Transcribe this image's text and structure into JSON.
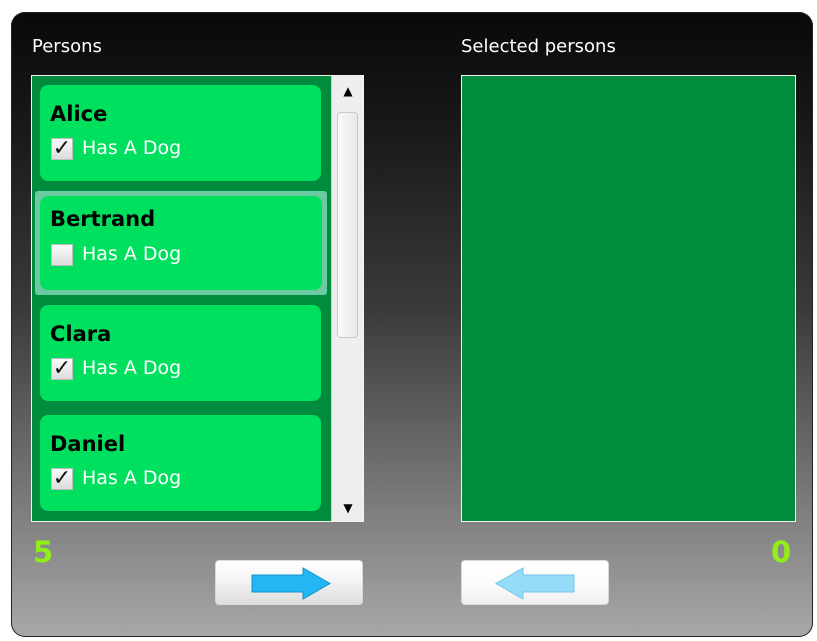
{
  "persons_panel": {
    "title": "Persons",
    "count": "5",
    "items": [
      {
        "name": "Alice",
        "has_dog_label": "Has A Dog",
        "has_dog": true
      },
      {
        "name": "Bertrand",
        "has_dog_label": "Has A Dog",
        "has_dog": false
      },
      {
        "name": "Clara",
        "has_dog_label": "Has A Dog",
        "has_dog": true
      },
      {
        "name": "Daniel",
        "has_dog_label": "Has A Dog",
        "has_dog": true
      }
    ]
  },
  "selected_panel": {
    "title": "Selected persons",
    "count": "0"
  },
  "icons": {
    "checkmark": "✓",
    "scroll_up": "▲",
    "scroll_down": "▼",
    "move_right": "right-arrow-icon",
    "move_left": "left-arrow-icon"
  },
  "colors": {
    "list_background": "#008b3d",
    "item_background": "#00e05f",
    "selected_item_border": "#6ccaa2",
    "count_color": "#92ee17",
    "active_arrow": "#22b7f3",
    "inactive_arrow": "#95dcf8"
  }
}
